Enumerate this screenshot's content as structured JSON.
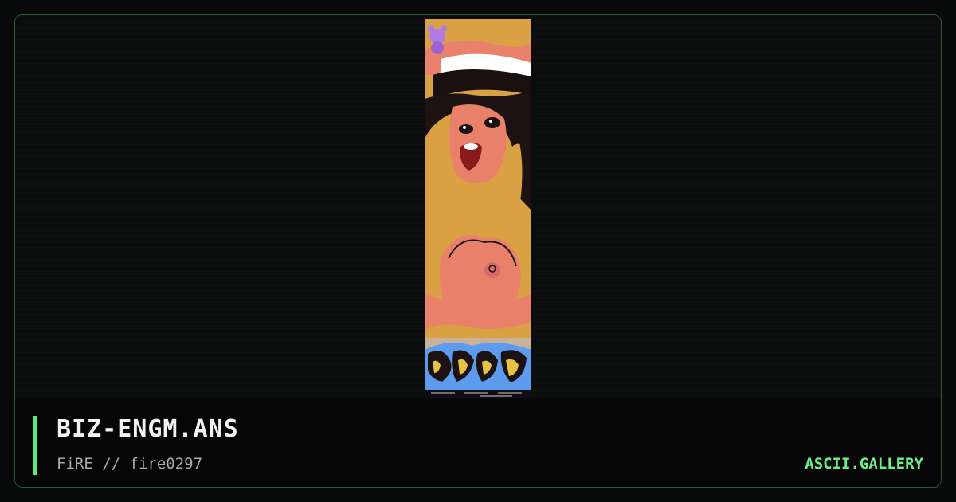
{
  "artwork": {
    "title": "BIZ-ENGM.ANS",
    "credit": "FiRE // fire0297",
    "image_description_icon": "ansi-art-image"
  },
  "site": {
    "brand": "ASCII.GALLERY"
  },
  "colors": {
    "accent": "#5ee87a",
    "brand_text": "#6cf08a",
    "frame_border": "#2b5a33",
    "background": "#0a0c0b"
  }
}
